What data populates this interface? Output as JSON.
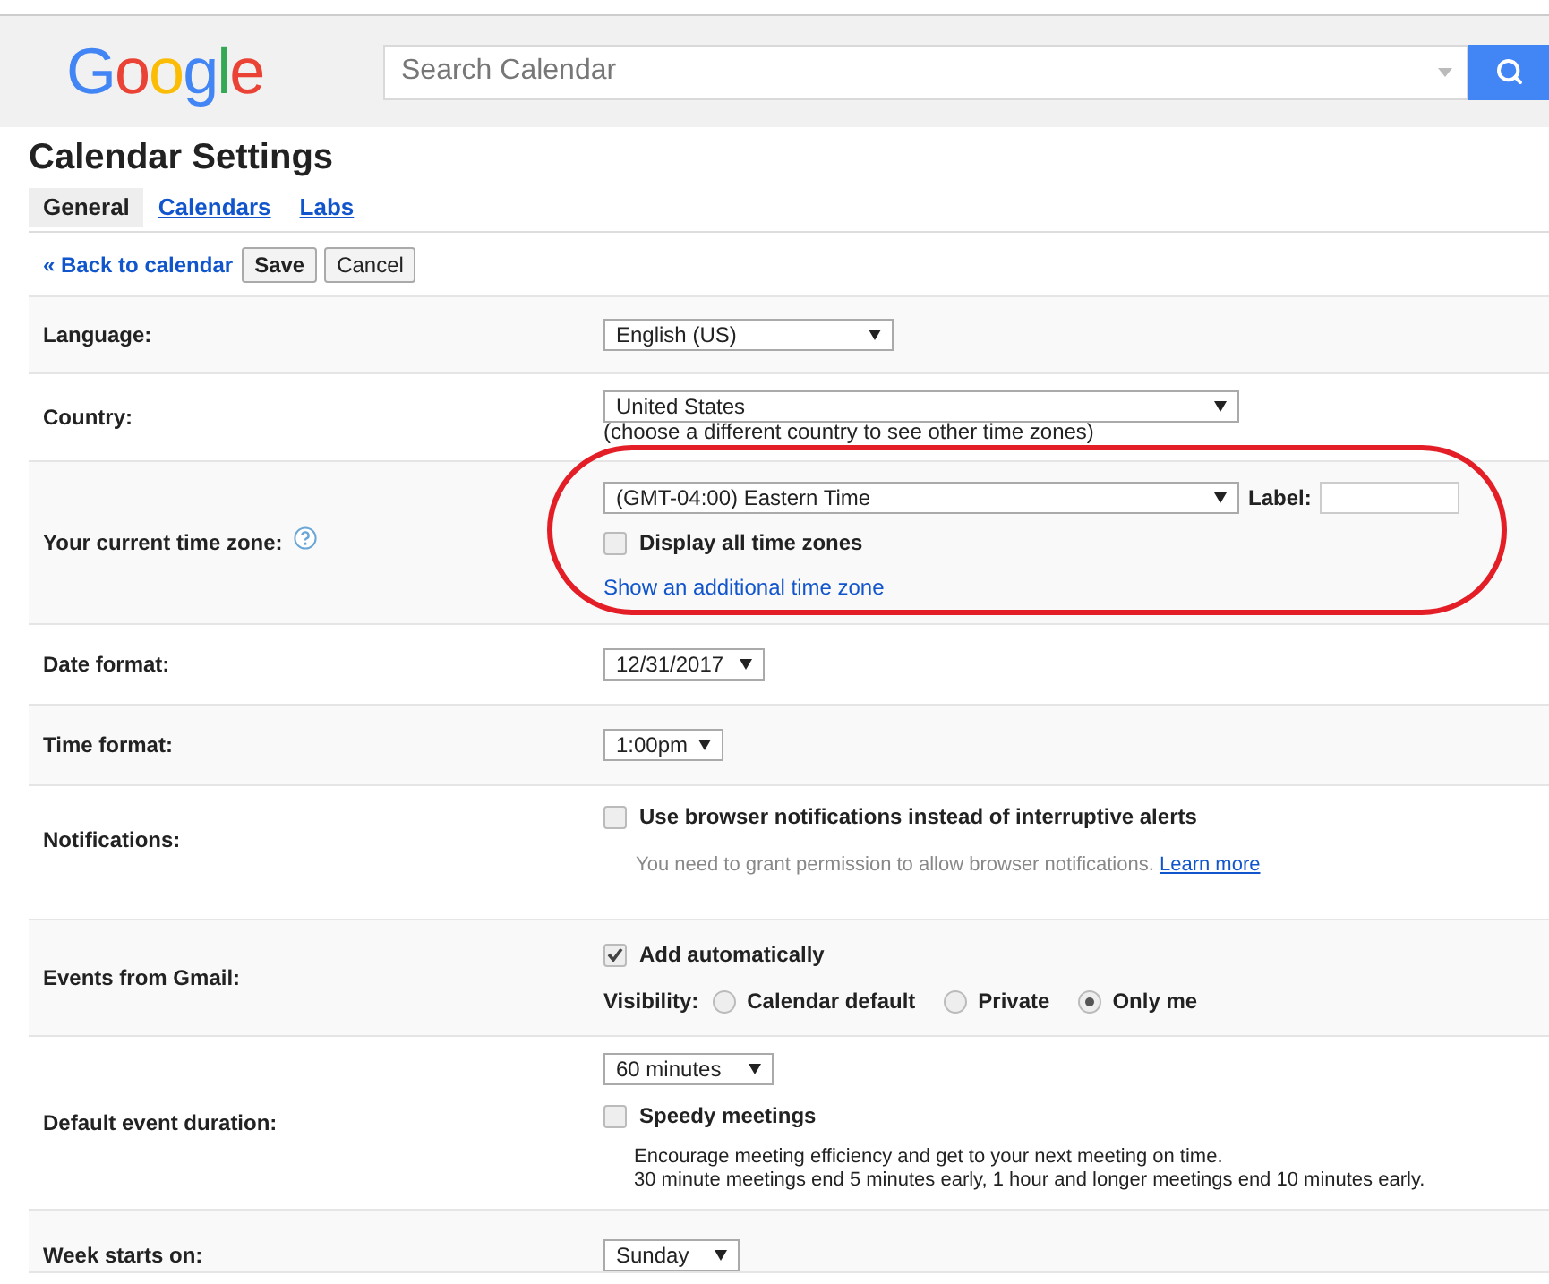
{
  "header": {
    "logo": "Google",
    "search": {
      "placeholder": "Search Calendar"
    }
  },
  "title": "Calendar Settings",
  "tabs": [
    {
      "label": "General",
      "selected": true
    },
    {
      "label": "Calendars",
      "selected": false
    },
    {
      "label": "Labs",
      "selected": false
    }
  ],
  "actions": {
    "back_link": "« Back to calendar",
    "buttons": [
      "Save",
      "Cancel"
    ]
  },
  "settings": [
    {
      "label": "Language:",
      "highlighted": false,
      "controls": [
        {
          "kind": "select",
          "value": "English (US)"
        }
      ]
    },
    {
      "label": "Country:",
      "highlighted": false,
      "controls": [
        {
          "kind": "select",
          "value": "United States"
        },
        {
          "kind": "note",
          "text": "(choose a different country to see other time zones)"
        }
      ]
    },
    {
      "label": "Your current time zone:",
      "help": true,
      "highlighted": true,
      "controls": [
        {
          "kind": "select",
          "value": "(GMT-04:00) Eastern Time",
          "field_label": "Label:"
        },
        {
          "kind": "checkbox",
          "label": "Display all time zones",
          "checked": false
        },
        {
          "kind": "link",
          "text": "Show an additional time zone"
        }
      ]
    },
    {
      "label": "Date format:",
      "highlighted": false,
      "controls": [
        {
          "kind": "select",
          "value": "12/31/2017"
        }
      ]
    },
    {
      "label": "Time format:",
      "highlighted": false,
      "controls": [
        {
          "kind": "select",
          "value": "1:00pm"
        }
      ]
    },
    {
      "label": "Notifications:",
      "highlighted": false,
      "controls": [
        {
          "kind": "checkbox",
          "label": "Use browser notifications instead of interruptive alerts",
          "checked": false
        },
        {
          "kind": "hint",
          "text": "You need to grant permission to allow browser notifications.",
          "link": "Learn more"
        }
      ]
    },
    {
      "label": "Events from Gmail:",
      "highlighted": false,
      "controls": [
        {
          "kind": "checkbox",
          "label": "Add automatically",
          "checked": true
        },
        {
          "kind": "radio_group",
          "label": "Visibility:",
          "options": [
            {
              "label": "Calendar default",
              "selected": false
            },
            {
              "label": "Private",
              "selected": false
            },
            {
              "label": "Only me",
              "selected": true
            }
          ]
        }
      ]
    },
    {
      "label": "Default event duration:",
      "highlighted": false,
      "controls": [
        {
          "kind": "select",
          "value": "60 minutes"
        },
        {
          "kind": "checkbox",
          "label": "Speedy meetings",
          "checked": false
        },
        {
          "kind": "description",
          "lines": [
            "Encourage meeting efficiency and get to your next meeting on time.",
            "30 minute meetings end 5 minutes early, 1 hour and longer meetings end 10 minutes early."
          ]
        }
      ]
    },
    {
      "label": "Week starts on:",
      "highlighted": false,
      "controls": [
        {
          "kind": "select",
          "value": "Sunday"
        }
      ]
    }
  ]
}
